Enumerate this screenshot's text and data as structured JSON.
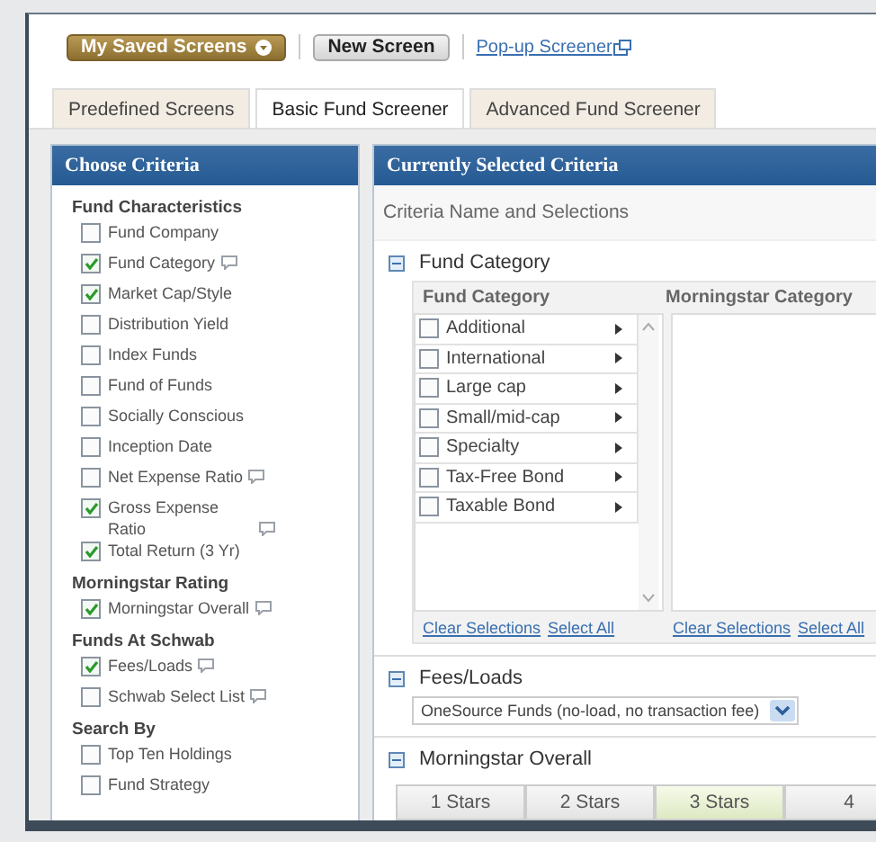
{
  "toolbar": {
    "saved_button": "My Saved Screens",
    "new_button": "New Screen",
    "popup_link": "Pop-up Screener"
  },
  "tabs": [
    {
      "label": "Predefined Screens",
      "selected": false
    },
    {
      "label": "Basic Fund Screener",
      "selected": true
    },
    {
      "label": "Advanced Fund Screener",
      "selected": false
    }
  ],
  "criteria_panel": {
    "title": "Choose Criteria",
    "groups": [
      {
        "title": "Fund Characteristics",
        "items": [
          {
            "label": "Fund Company",
            "checked": false,
            "info": false
          },
          {
            "label": "Fund Category",
            "checked": true,
            "info": true
          },
          {
            "label": "Market Cap/Style",
            "checked": true,
            "info": false
          },
          {
            "label": "Distribution Yield",
            "checked": false,
            "info": false
          },
          {
            "label": "Index Funds",
            "checked": false,
            "info": false
          },
          {
            "label": "Fund of Funds",
            "checked": false,
            "info": false
          },
          {
            "label": "Socially Conscious",
            "checked": false,
            "info": false
          },
          {
            "label": "Inception Date",
            "checked": false,
            "info": false
          },
          {
            "label": "Net Expense Ratio",
            "checked": false,
            "info": true
          },
          {
            "label": "Gross Expense Ratio",
            "checked": true,
            "info": true
          },
          {
            "label": "Total Return (3 Yr)",
            "checked": true,
            "info": false
          }
        ]
      },
      {
        "title": "Morningstar Rating",
        "items": [
          {
            "label": "Morningstar Overall",
            "checked": true,
            "info": true
          }
        ]
      },
      {
        "title": "Funds At Schwab",
        "items": [
          {
            "label": "Fees/Loads",
            "checked": true,
            "info": true
          },
          {
            "label": "Schwab Select List",
            "checked": false,
            "info": true
          }
        ]
      },
      {
        "title": "Search By",
        "items": [
          {
            "label": "Top Ten Holdings",
            "checked": false,
            "info": false
          },
          {
            "label": "Fund Strategy",
            "checked": false,
            "info": false
          }
        ]
      }
    ]
  },
  "selected_panel": {
    "title": "Currently Selected Criteria",
    "subheader": "Criteria Name and Selections",
    "sections": [
      {
        "kind": "category",
        "title": "Fund Category",
        "columns": [
          "Fund Category",
          "Morningstar Category"
        ],
        "items": [
          {
            "label": "Additional",
            "checked": false
          },
          {
            "label": "International",
            "checked": false
          },
          {
            "label": "Large cap",
            "checked": false
          },
          {
            "label": "Small/mid-cap",
            "checked": false
          },
          {
            "label": "Specialty",
            "checked": false
          },
          {
            "label": "Tax-Free Bond",
            "checked": false
          },
          {
            "label": "Taxable Bond",
            "checked": false
          }
        ],
        "footer_links": [
          [
            "Clear Selections",
            "Select All"
          ],
          [
            "Clear Selections",
            "Select All"
          ]
        ]
      },
      {
        "kind": "dropdown",
        "title": "Fees/Loads",
        "value": "OneSource Funds (no-load, no transaction fee)"
      },
      {
        "kind": "stars",
        "title": "Morningstar Overall",
        "options": [
          {
            "label": "1 Stars",
            "selected": false
          },
          {
            "label": "2 Stars",
            "selected": false
          },
          {
            "label": "3 Stars",
            "selected": true
          },
          {
            "label": "4",
            "selected": false
          }
        ]
      }
    ]
  }
}
